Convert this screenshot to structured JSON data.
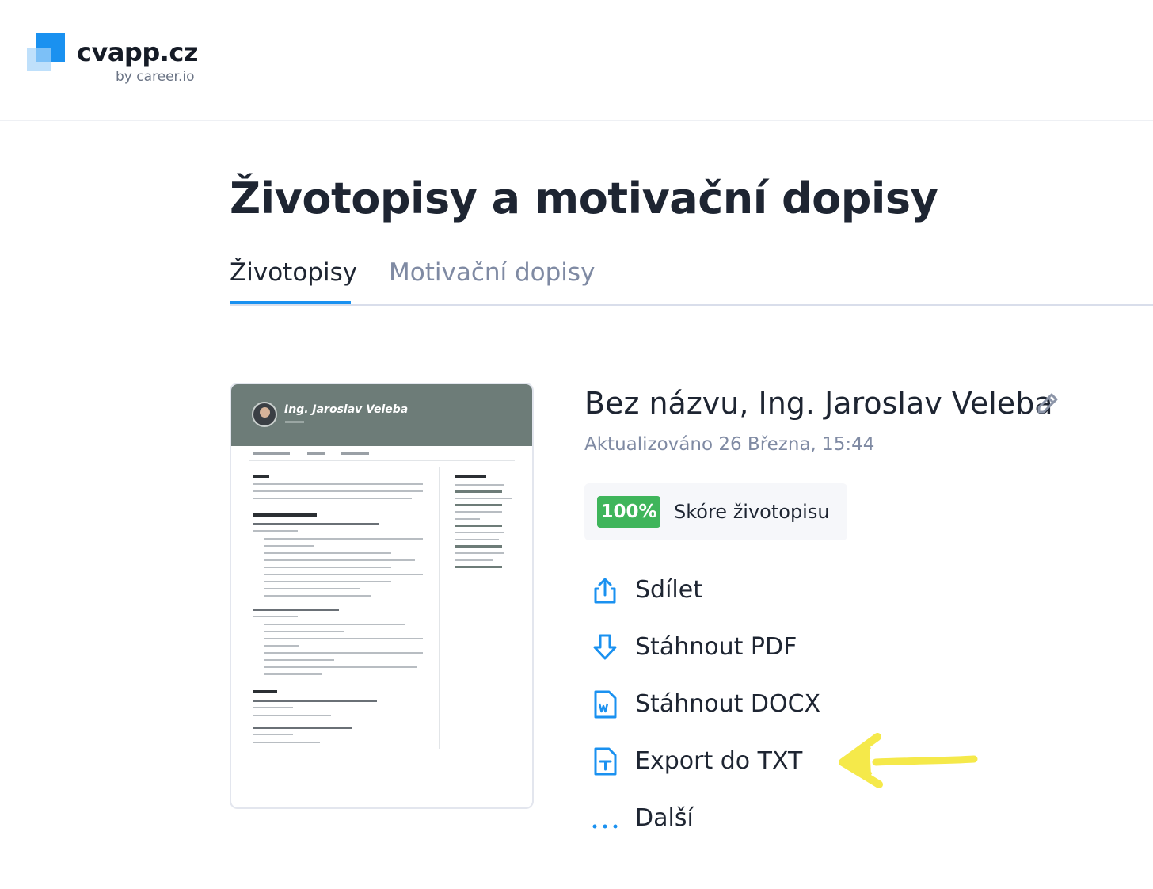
{
  "brand": {
    "name": "cvapp.cz",
    "subtitle": "by career.io",
    "colors": {
      "primary": "#1a91f0",
      "light": "#bfe0fb"
    }
  },
  "page": {
    "title": "Životopisy a motivační dopisy"
  },
  "tabs": [
    {
      "label": "Životopisy",
      "active": true
    },
    {
      "label": "Motivační dopisy",
      "active": false
    }
  ],
  "resume_preview": {
    "name": "Ing. Jaroslav Veleba",
    "header_color": "#6d7c78"
  },
  "document": {
    "title": "Bez názvu, Ing. Jaroslav Veleba",
    "updated": "Aktualizováno 26 Března, 15:44",
    "score_value": "100%",
    "score_label": "Skóre životopisu",
    "score_color": "#3fb55b"
  },
  "actions": [
    {
      "label": "Sdílet",
      "icon": "share-icon"
    },
    {
      "label": "Stáhnout PDF",
      "icon": "download-icon"
    },
    {
      "label": "Stáhnout DOCX",
      "icon": "docx-file-icon"
    },
    {
      "label": "Export do TXT",
      "icon": "txt-file-icon"
    },
    {
      "label": "Další",
      "icon": "more-dots-icon"
    }
  ],
  "annotation": {
    "icon": "yellow-arrow-icon",
    "color": "#f5e94a"
  }
}
